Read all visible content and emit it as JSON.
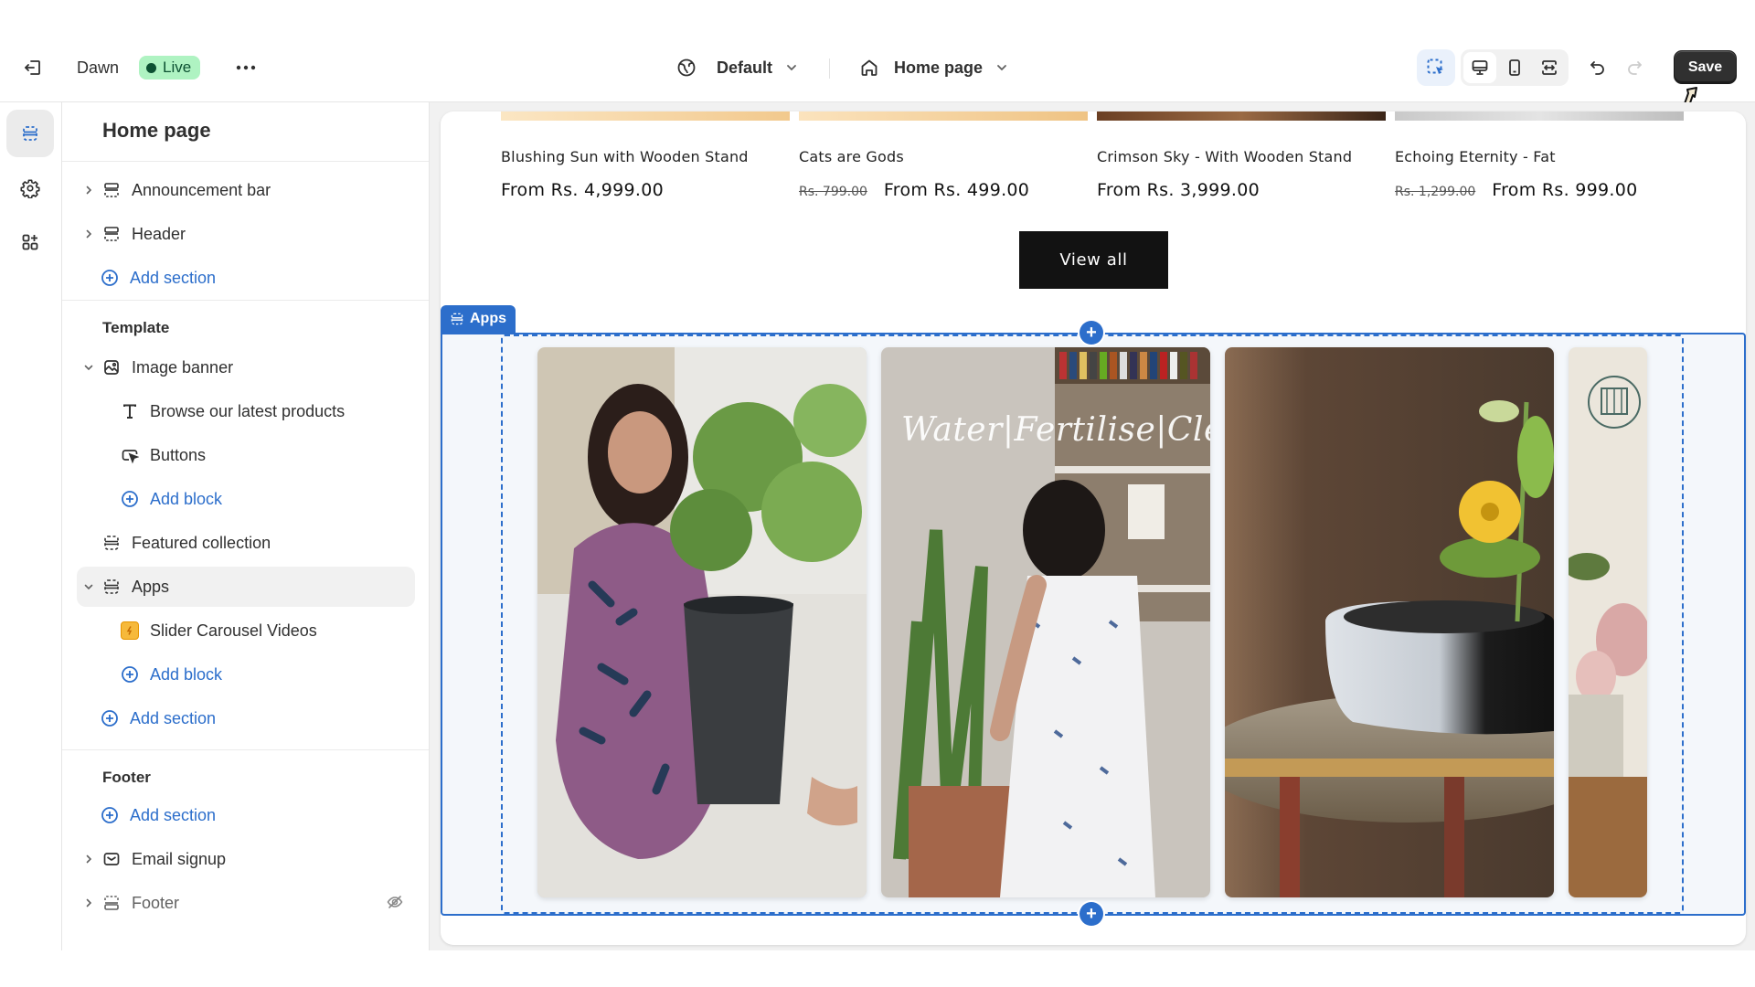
{
  "topbar": {
    "exit_icon": "exit-icon",
    "theme_name": "Dawn",
    "status_badge": "Live",
    "more_icon": "ellipsis-icon",
    "locale_label": "Default",
    "page_label": "Home page",
    "save_label": "Save",
    "colors": {
      "live_bg": "#aff3c2",
      "live_fg": "#0c5132",
      "save_bg": "#303030",
      "accent": "#2c6ecb"
    }
  },
  "rail": {
    "items": [
      {
        "name": "sections",
        "icon": "sections-icon",
        "active": true
      },
      {
        "name": "theme-settings",
        "icon": "gear-icon",
        "active": false
      },
      {
        "name": "app-embeds",
        "icon": "apps-add-icon",
        "active": false
      }
    ]
  },
  "sidebar": {
    "title": "Home page",
    "header_group": {
      "items": [
        {
          "label": "Announcement bar",
          "icon": "section-icon",
          "expanded": false
        },
        {
          "label": "Header",
          "icon": "section-icon",
          "expanded": false
        }
      ],
      "add_section": "Add section"
    },
    "template_group": {
      "heading": "Template",
      "image_banner": {
        "label": "Image banner",
        "expanded": true,
        "blocks": [
          {
            "label": "Browse our latest products",
            "icon": "text-icon"
          },
          {
            "label": "Buttons",
            "icon": "button-icon"
          }
        ],
        "add_block": "Add block"
      },
      "featured_collection": {
        "label": "Featured collection"
      },
      "apps": {
        "label": "Apps",
        "expanded": true,
        "selected": true,
        "blocks": [
          {
            "label": "Slider Carousel Videos",
            "icon": "app-icon"
          }
        ],
        "add_block": "Add block"
      },
      "add_section": "Add section"
    },
    "footer_group": {
      "heading": "Footer",
      "add_section": "Add section",
      "items": [
        {
          "label": "Email signup",
          "icon": "email-icon",
          "hidden": false
        },
        {
          "label": "Footer",
          "icon": "footer-icon",
          "hidden": true
        }
      ]
    }
  },
  "preview": {
    "products": [
      {
        "name": "Blushing Sun with Wooden Stand",
        "old_price": "",
        "price": "From Rs. 4,999.00"
      },
      {
        "name": "Cats are Gods",
        "old_price": "Rs. 799.00",
        "price": "From Rs. 499.00"
      },
      {
        "name": "Crimson Sky - With Wooden Stand",
        "old_price": "",
        "price": "From Rs. 3,999.00"
      },
      {
        "name": "Echoing Eternity - Fat",
        "old_price": "Rs. 1,299.00",
        "price": "From Rs. 999.00"
      }
    ],
    "view_all_label": "View all",
    "apps_tag_label": "Apps",
    "videos": [
      {
        "description": "Woman in floral dress holding a potted plant"
      },
      {
        "description": "Woman tending a snake plant",
        "overlay_text": "Water|Fertilise|Clean"
      },
      {
        "description": "Ceramic bowl planter with yellow flower on engraved table"
      },
      {
        "description": "Pink plant with brand logo (partially visible)"
      }
    ]
  }
}
